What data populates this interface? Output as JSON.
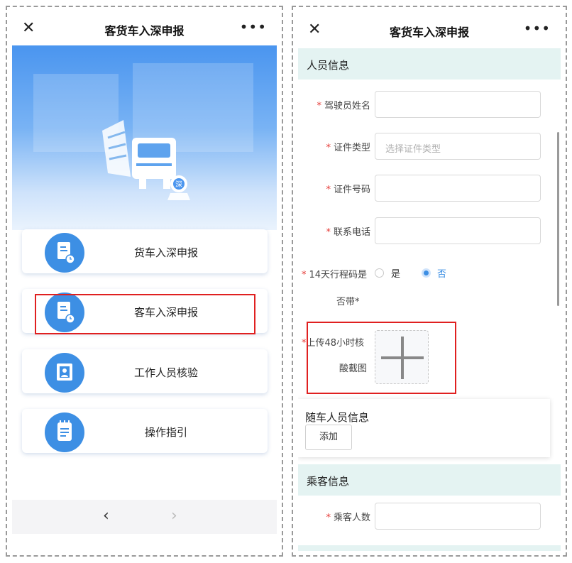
{
  "left": {
    "title": "客货车入深申报",
    "menu": [
      {
        "label": "货车入深申报",
        "icon": "document-clock-icon"
      },
      {
        "label": "客车入深申报",
        "icon": "document-clock-icon"
      },
      {
        "label": "工作人员核验",
        "icon": "person-badge-icon"
      },
      {
        "label": "操作指引",
        "icon": "notepad-icon"
      }
    ],
    "hero_badge": "深"
  },
  "right": {
    "title": "客货车入深申报",
    "section_personnel": "人员信息",
    "fields": {
      "driver_name": {
        "label": "驾驶员姓名",
        "value": ""
      },
      "id_type": {
        "label": "证件类型",
        "placeholder": "选择证件类型"
      },
      "id_number": {
        "label": "证件号码",
        "value": ""
      },
      "phone": {
        "label": "联系电话",
        "value": ""
      }
    },
    "trip_code": {
      "label_line1": "14天行程码是",
      "label_line2": "否带*",
      "option_yes": "是",
      "option_no": "否",
      "selected": "否"
    },
    "upload": {
      "label_line1": "上传48小时核",
      "label_line2": "酸截图"
    },
    "companions": {
      "title": "随车人员信息",
      "add_label": "添加"
    },
    "section_passenger": "乘客信息",
    "passenger_count": {
      "label": "乘客人数",
      "value": ""
    }
  },
  "colors": {
    "accent": "#3d8fe4",
    "section_bg": "#e4f3f2",
    "highlight": "#e02020",
    "required": "#e53935"
  }
}
